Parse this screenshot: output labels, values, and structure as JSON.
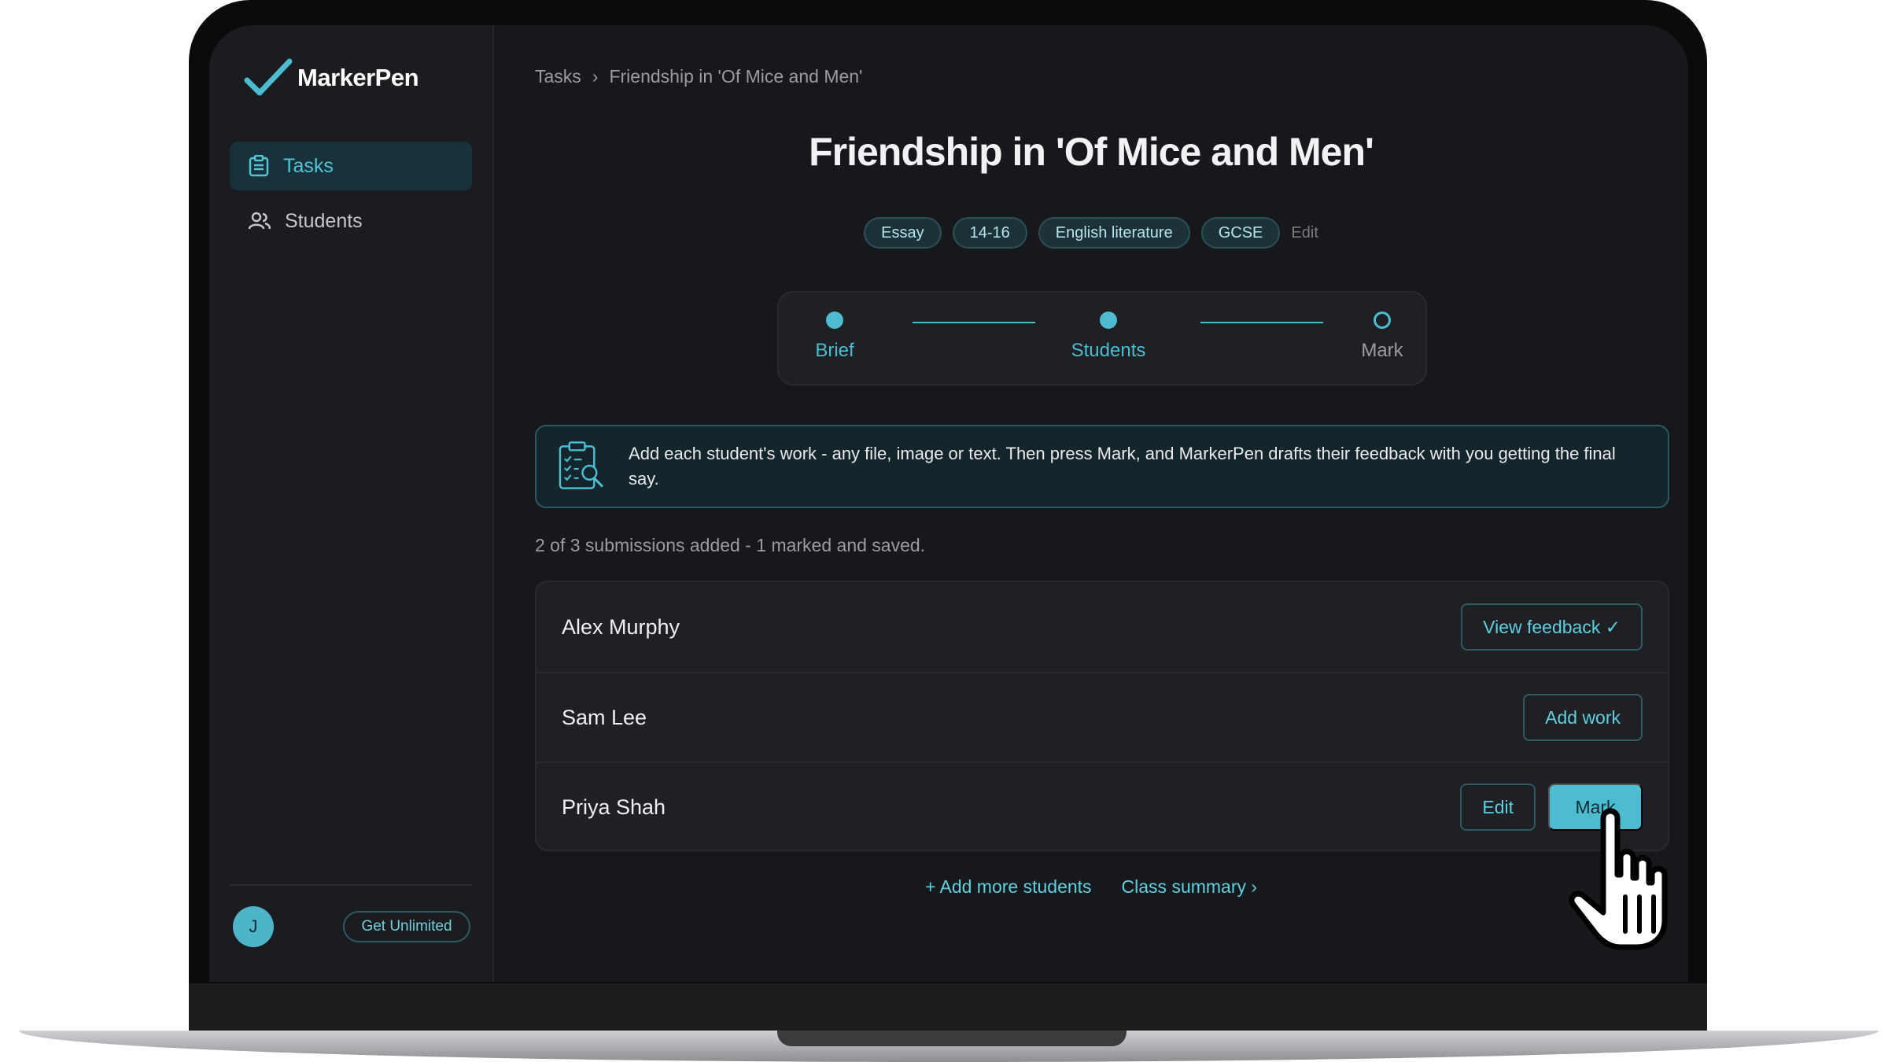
{
  "app": {
    "name": "MarkerPen"
  },
  "sidebar": {
    "items": [
      {
        "label": "Tasks",
        "icon": "clipboard-icon",
        "active": true
      },
      {
        "label": "Students",
        "icon": "people-icon",
        "active": false
      }
    ],
    "avatar_initial": "J",
    "upgrade_label": "Get Unlimited"
  },
  "breadcrumb": {
    "root": "Tasks",
    "separator": "›",
    "current": "Friendship in 'Of Mice and Men'"
  },
  "task": {
    "title": "Friendship in 'Of Mice and Men'",
    "tags": [
      "Essay",
      "14-16",
      "English literature",
      "GCSE"
    ],
    "tags_edit_label": "Edit"
  },
  "stepper": {
    "steps": [
      {
        "label": "Brief",
        "state": "complete"
      },
      {
        "label": "Students",
        "state": "current"
      },
      {
        "label": "Mark",
        "state": "pending"
      }
    ]
  },
  "banner": {
    "icon": "clipboard-search-icon",
    "text": "Add each student's work - any file, image or text. Then press Mark, and MarkerPen drafts their feedback with you getting the final say."
  },
  "summary": "2 of 3 submissions added - 1 marked and saved.",
  "students": [
    {
      "name": "Alex Murphy",
      "actions": [
        {
          "label": "View feedback ✓",
          "style": "outline"
        }
      ]
    },
    {
      "name": "Sam Lee",
      "actions": [
        {
          "label": "Add work",
          "style": "outline"
        }
      ]
    },
    {
      "name": "Priya Shah",
      "actions": [
        {
          "label": "Edit",
          "style": "outline"
        },
        {
          "label": "Mark",
          "style": "fill"
        }
      ]
    }
  ],
  "footer": {
    "add_more": "+ Add more students",
    "class_summary": "Class summary ›"
  },
  "colors": {
    "accent": "#4dbcd0",
    "background": "#17181b",
    "sidebar": "#1b1c1f"
  }
}
